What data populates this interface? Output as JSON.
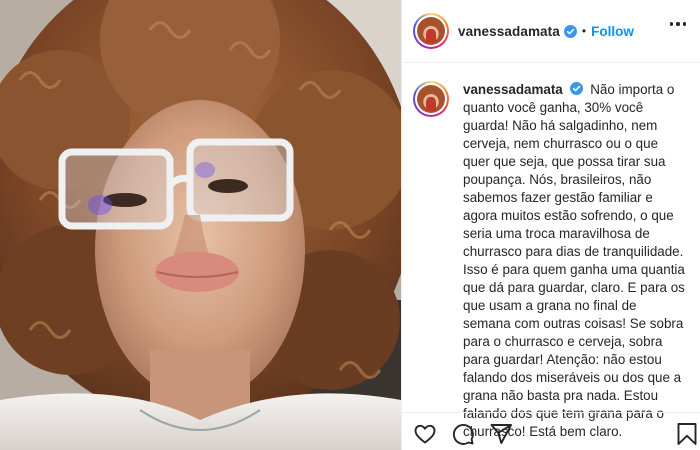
{
  "post": {
    "username": "vanessadamata",
    "verified": true,
    "separator": "•",
    "follow_label": "Follow",
    "caption": "Não importa o quanto você ganha, 30% você guarda! Não há salgadinho, nem cerveja, nem churrasco ou o que quer que seja, que possa tirar sua poupança. Nós, brasileiros, não sabemos fazer gestão familiar e agora muitos estão sofrendo, o que seria uma troca maravilhosa de churrasco para dias de tranquilidade. Isso é para quem ganha uma quantia que dá para guardar, claro. E para os que usam a grana no final de semana com outras coisas! Se sobra para o churrasco e cerveja, sobra para guardar! Atenção: não estou falando dos miseráveis ou dos que a grana não basta pra nada. Estou falando dos que tem grana para o churrasco! Está bem claro."
  },
  "icons": {
    "verified": "verified-badge-icon",
    "more": "more-options-icon",
    "like": "heart-icon",
    "comment": "comment-icon",
    "share": "paper-plane-icon",
    "save": "bookmark-icon"
  },
  "colors": {
    "accent": "#0095f6",
    "text": "#262626",
    "border": "#efefef"
  }
}
